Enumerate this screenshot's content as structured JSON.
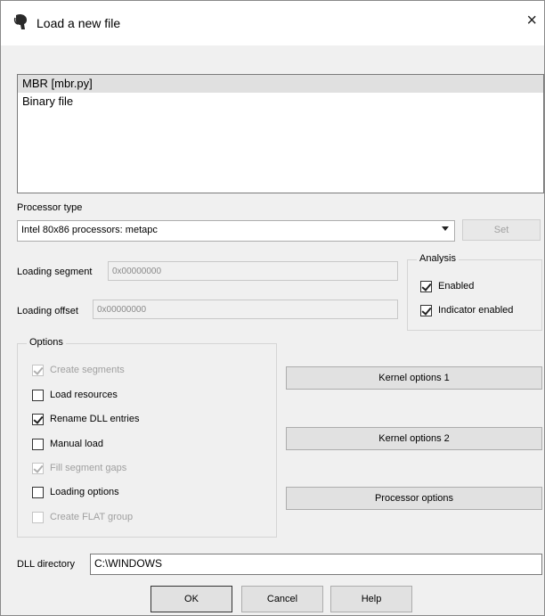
{
  "window": {
    "title": "Load a new file",
    "close_glyph": "×",
    "app_icon": "ida-icon"
  },
  "loaders": {
    "items": [
      {
        "label": "MBR [mbr.py]",
        "selected": true
      },
      {
        "label": "Binary file",
        "selected": false
      }
    ]
  },
  "processor": {
    "label": "Processor type",
    "value": "Intel 80x86 processors: metapc",
    "set_label": "Set"
  },
  "loading": {
    "segment_label": "Loading segment",
    "segment_value": "0x00000000",
    "offset_label": "Loading offset",
    "offset_value": "0x00000000"
  },
  "analysis": {
    "title": "Analysis",
    "enabled_label": "Enabled",
    "enabled_checked": true,
    "indicator_label": "Indicator enabled",
    "indicator_checked": true
  },
  "options": {
    "title": "Options",
    "items": [
      {
        "label": "Create segments",
        "checked": true,
        "disabled": true
      },
      {
        "label": "Load resources",
        "checked": false,
        "disabled": false
      },
      {
        "label": "Rename DLL entries",
        "checked": true,
        "disabled": false
      },
      {
        "label": "Manual load",
        "checked": false,
        "disabled": false
      },
      {
        "label": "Fill segment gaps",
        "checked": true,
        "disabled": true
      },
      {
        "label": "Loading options",
        "checked": false,
        "disabled": false
      },
      {
        "label": "Create FLAT group",
        "checked": false,
        "disabled": true
      }
    ]
  },
  "side_buttons": {
    "kernel1": "Kernel options 1",
    "kernel2": "Kernel options 2",
    "processor": "Processor options"
  },
  "dll": {
    "label": "DLL directory",
    "value": "C:\\WINDOWS"
  },
  "footer": {
    "ok": "OK",
    "cancel": "Cancel",
    "help": "Help"
  }
}
